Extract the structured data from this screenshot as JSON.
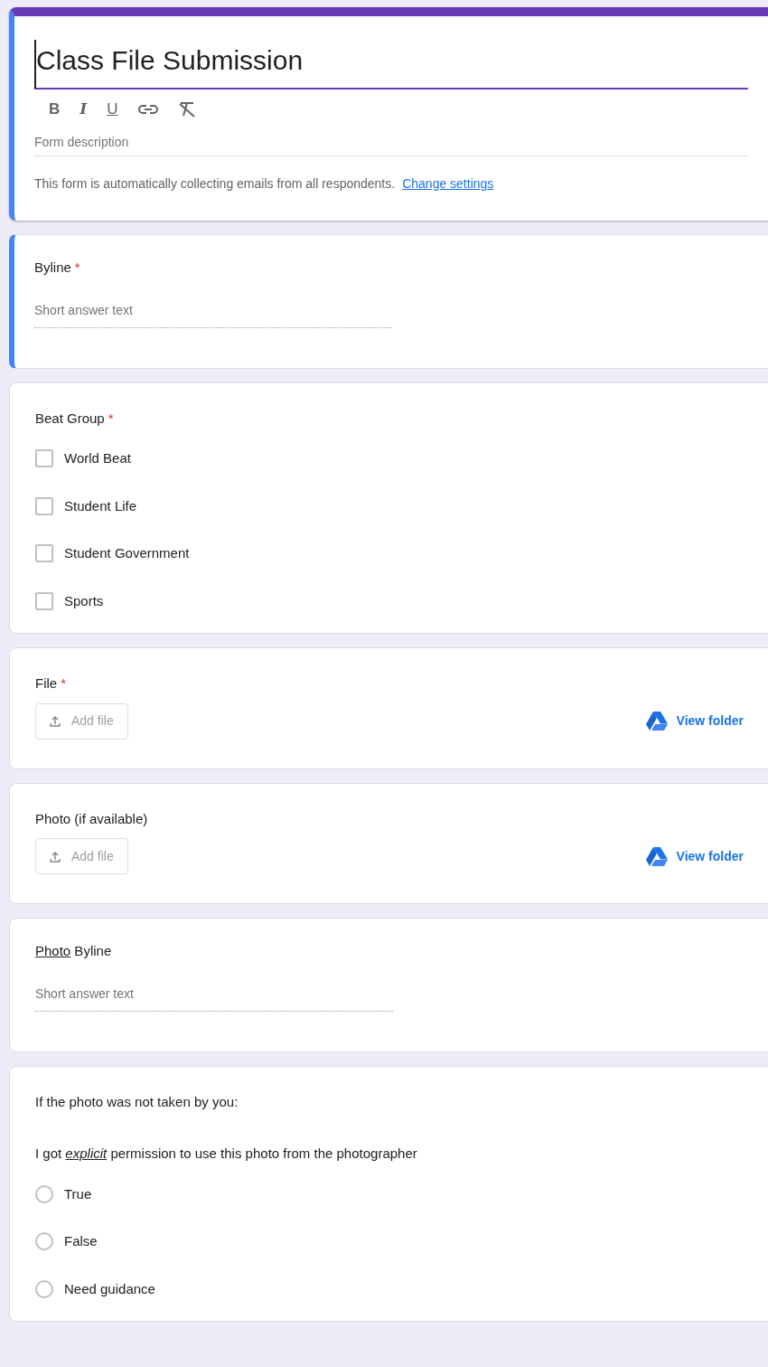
{
  "header": {
    "title": "Class File Submission",
    "toolbar": [
      "B",
      "I",
      "U"
    ],
    "description_placeholder": "Form description",
    "notice": "This form is automatically collecting emails from all respondents.",
    "notice_link": "Change settings"
  },
  "required_mark": "*",
  "questions": [
    {
      "kind": "short_answer",
      "selected": true,
      "title": [
        {
          "text": "Byline",
          "underline": false,
          "italic": false
        }
      ],
      "required": true,
      "placeholder": "Short answer text"
    },
    {
      "kind": "checkboxes",
      "selected": false,
      "title": [
        {
          "text": "Beat Group",
          "underline": false,
          "italic": false
        }
      ],
      "required": true,
      "options": [
        {
          "label": "World Beat",
          "checked": false
        },
        {
          "label": "Student Life",
          "checked": false
        },
        {
          "label": "Student Government",
          "checked": false
        },
        {
          "label": "Sports",
          "checked": false
        }
      ]
    },
    {
      "kind": "file_upload",
      "selected": false,
      "title": [
        {
          "text": "File",
          "underline": false,
          "italic": false
        }
      ],
      "required": true,
      "button": "Add file",
      "link": "View folder"
    },
    {
      "kind": "file_upload",
      "selected": false,
      "title": [
        {
          "text": "Photo (if available)",
          "underline": false,
          "italic": false
        }
      ],
      "required": false,
      "button": "Add file",
      "link": "View folder"
    },
    {
      "kind": "short_answer",
      "selected": false,
      "title": [
        {
          "text": "Photo",
          "underline": true,
          "italic": false
        },
        {
          "text": " Byline",
          "underline": false,
          "italic": false
        }
      ],
      "required": false,
      "placeholder": "Short answer text"
    },
    {
      "kind": "radio",
      "selected": false,
      "title": [
        {
          "text": "If the photo was not taken by you:",
          "underline": false,
          "italic": false
        }
      ],
      "required": false,
      "description": [
        {
          "text": "I got ",
          "underline": false,
          "italic": false
        },
        {
          "text": "explicit",
          "underline": true,
          "italic": true
        },
        {
          "text": " permission to use this photo from the photographer",
          "underline": false,
          "italic": false
        }
      ],
      "options": [
        {
          "label": "True",
          "checked": false
        },
        {
          "label": "False",
          "checked": false
        },
        {
          "label": "Need guidance",
          "checked": false
        }
      ]
    }
  ]
}
